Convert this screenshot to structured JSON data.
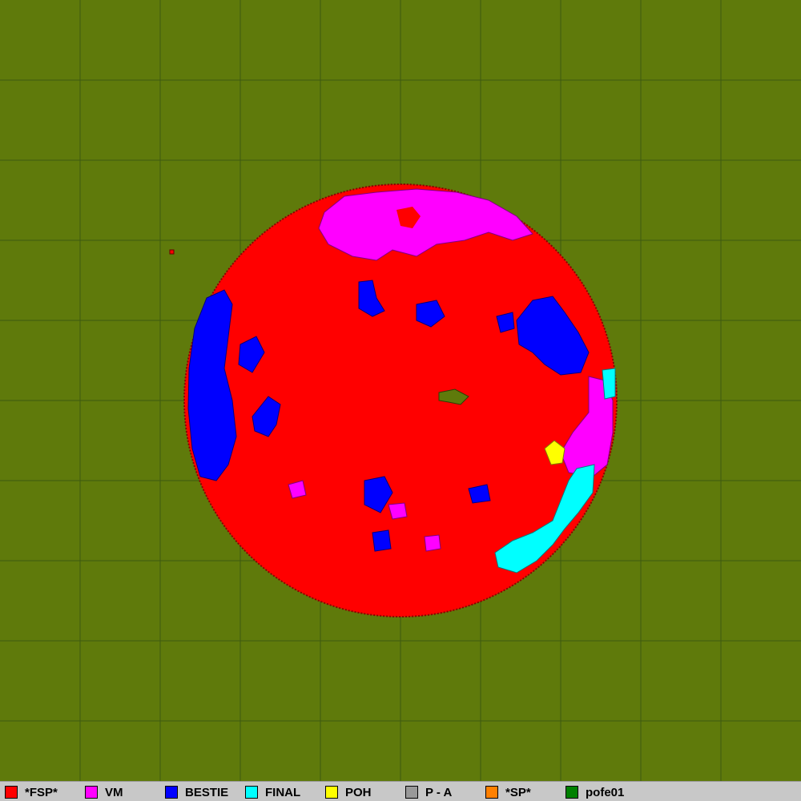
{
  "colors": {
    "background": "#5f7a0b",
    "grid": "#3e5a10",
    "legend_bg": "#c8c8c8"
  },
  "teams": [
    {
      "name": "*FSP*",
      "color": "#ff0000"
    },
    {
      "name": "VM",
      "color": "#ff00ff"
    },
    {
      "name": "BESTIE",
      "color": "#0000ff"
    },
    {
      "name": "FINAL",
      "color": "#00ffff"
    },
    {
      "name": "POH",
      "color": "#ffff00"
    },
    {
      "name": "P - A",
      "color": "#999999"
    },
    {
      "name": "*SP*",
      "color": "#ff8000"
    },
    {
      "name": "pofe01",
      "color": "#008000"
    }
  ]
}
